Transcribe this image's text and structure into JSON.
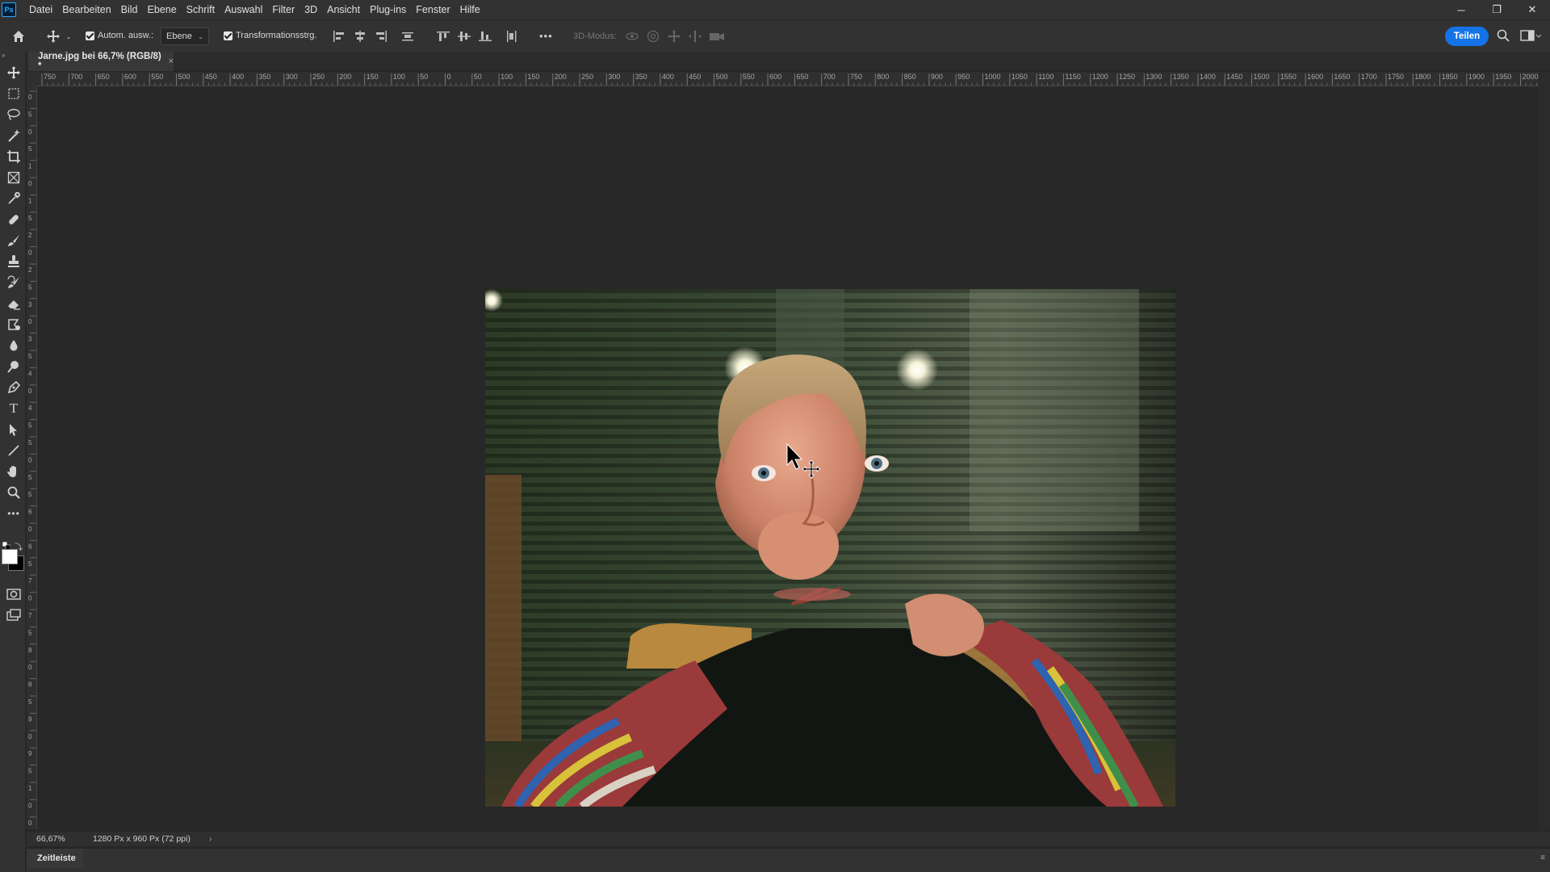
{
  "app": {
    "logo_text": "Ps"
  },
  "menu": [
    "Datei",
    "Bearbeiten",
    "Bild",
    "Ebene",
    "Schrift",
    "Auswahl",
    "Filter",
    "3D",
    "Ansicht",
    "Plug-ins",
    "Fenster",
    "Hilfe"
  ],
  "window_controls": {
    "minimize": "─",
    "restore": "❐",
    "close": "✕"
  },
  "options": {
    "auto_select_label": "Autom. ausw.:",
    "auto_select_checked": true,
    "layer_dropdown": "Ebene",
    "transform_label": "Transformationsstrg.",
    "transform_checked": true,
    "more": "•••",
    "mode3d": "3D-Modus:",
    "share": "Teilen"
  },
  "document": {
    "tab_title": "Jarne.jpg bei 66,7% (RGB/8) *",
    "close": "×"
  },
  "ruler": {
    "h_labels": [
      "750",
      "700",
      "650",
      "600",
      "550",
      "500",
      "450",
      "400",
      "350",
      "300",
      "250",
      "200",
      "150",
      "100",
      "50",
      "0",
      "50",
      "100",
      "150",
      "200",
      "250",
      "300",
      "350",
      "400",
      "450",
      "500",
      "550",
      "600",
      "650",
      "700",
      "750",
      "800",
      "850",
      "900",
      "950",
      "1000",
      "1050",
      "1100",
      "1150",
      "1200",
      "1250",
      "1300",
      "1350",
      "1400",
      "1450",
      "1500",
      "1550",
      "1600",
      "1650",
      "1700",
      "1750",
      "1800",
      "1850",
      "1900",
      "1950",
      "2000"
    ],
    "v_labels": [
      "0",
      "5",
      "0",
      "5",
      "1",
      "0",
      "1",
      "5",
      "2",
      "0",
      "2",
      "5",
      "3",
      "0",
      "3",
      "5",
      "4",
      "0",
      "4",
      "5",
      "5",
      "0",
      "5",
      "5",
      "6",
      "0",
      "6",
      "5",
      "7",
      "0",
      "7",
      "5",
      "8",
      "0",
      "8",
      "5",
      "9",
      "0",
      "9",
      "5",
      "1",
      "0",
      "0"
    ]
  },
  "status": {
    "zoom": "66,67%",
    "dimensions": "1280 Px x 960 Px (72 ppi)",
    "arrow": "›"
  },
  "panels": {
    "timeline": "Zeitleiste",
    "menu_icon": "≡"
  },
  "colors": {
    "accent": "#1473e6",
    "foreground_swatch": "#ffffff",
    "background_swatch": "#000000"
  }
}
